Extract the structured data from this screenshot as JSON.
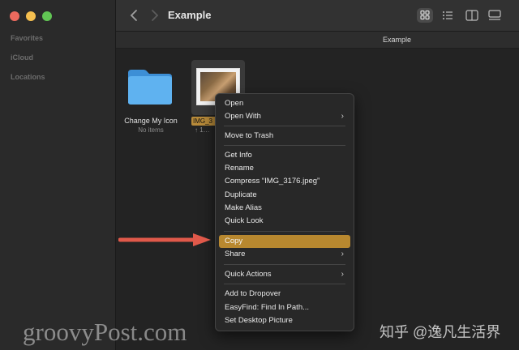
{
  "window": {
    "title": "Example",
    "path_title": "Example"
  },
  "sidebar": {
    "sections": [
      "Favorites",
      "iCloud",
      "Locations"
    ]
  },
  "toolbar": {
    "back_icon": "chevron-left-icon",
    "forward_icon": "chevron-right-icon",
    "view_modes": [
      "icon-view-icon",
      "list-view-icon",
      "column-view-icon",
      "gallery-view-icon"
    ],
    "active_view": "icon-view-icon"
  },
  "files": [
    {
      "name": "Change My Icon",
      "sub": "No items",
      "kind": "folder"
    },
    {
      "name": "IMG_3176.jpeg",
      "label_visible": "IMG_3",
      "sub": "↑ 1…",
      "kind": "image"
    }
  ],
  "context_menu": {
    "groups": [
      [
        "Open",
        "Open With"
      ],
      [
        "Move to Trash"
      ],
      [
        "Get Info",
        "Rename",
        "Compress “IMG_3176.jpeg”",
        "Duplicate",
        "Make Alias",
        "Quick Look"
      ],
      [
        "Copy",
        "Share"
      ],
      [
        "Quick Actions"
      ],
      [
        "Add to Dropover",
        "EasyFind: Find In Path...",
        "Set Desktop Picture"
      ]
    ],
    "highlighted": "Copy",
    "submenus": [
      "Open With",
      "Share",
      "Quick Actions"
    ]
  },
  "watermarks": {
    "left": "groovyPost.com",
    "right": "知乎 @逸凡生活界"
  },
  "colors": {
    "highlight": "#b8882f",
    "arrow": "#e0594a",
    "folder": "#4aa3e8"
  }
}
